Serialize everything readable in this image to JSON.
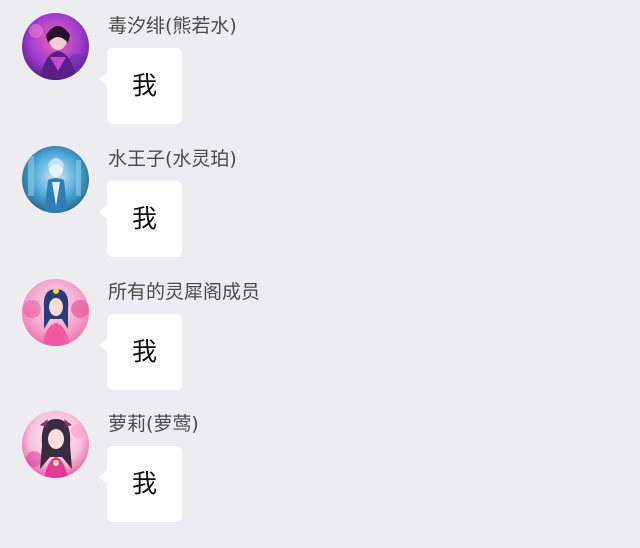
{
  "messages": [
    {
      "sender": "毒汐绯(熊若水)",
      "text": "我",
      "avatar_icon": "avatar-purple-warrior-icon",
      "avatar_colors": [
        "#3a1e5c",
        "#a23ad0",
        "#e86ab8"
      ]
    },
    {
      "sender": "水王子(水灵珀)",
      "text": "我",
      "avatar_icon": "avatar-ice-prince-icon",
      "avatar_colors": [
        "#0f3b5a",
        "#4aa7d6",
        "#cfeaf6"
      ]
    },
    {
      "sender": "所有的灵犀阁成员",
      "text": "我",
      "avatar_icon": "avatar-group-girls-icon",
      "avatar_colors": [
        "#f3a8cf",
        "#f15aa0",
        "#2a3a7a"
      ]
    },
    {
      "sender": "萝莉(萝莺)",
      "text": "我",
      "avatar_icon": "avatar-pink-girl-icon",
      "avatar_colors": [
        "#f7c2dc",
        "#e03a96",
        "#3a2b3e"
      ]
    }
  ]
}
